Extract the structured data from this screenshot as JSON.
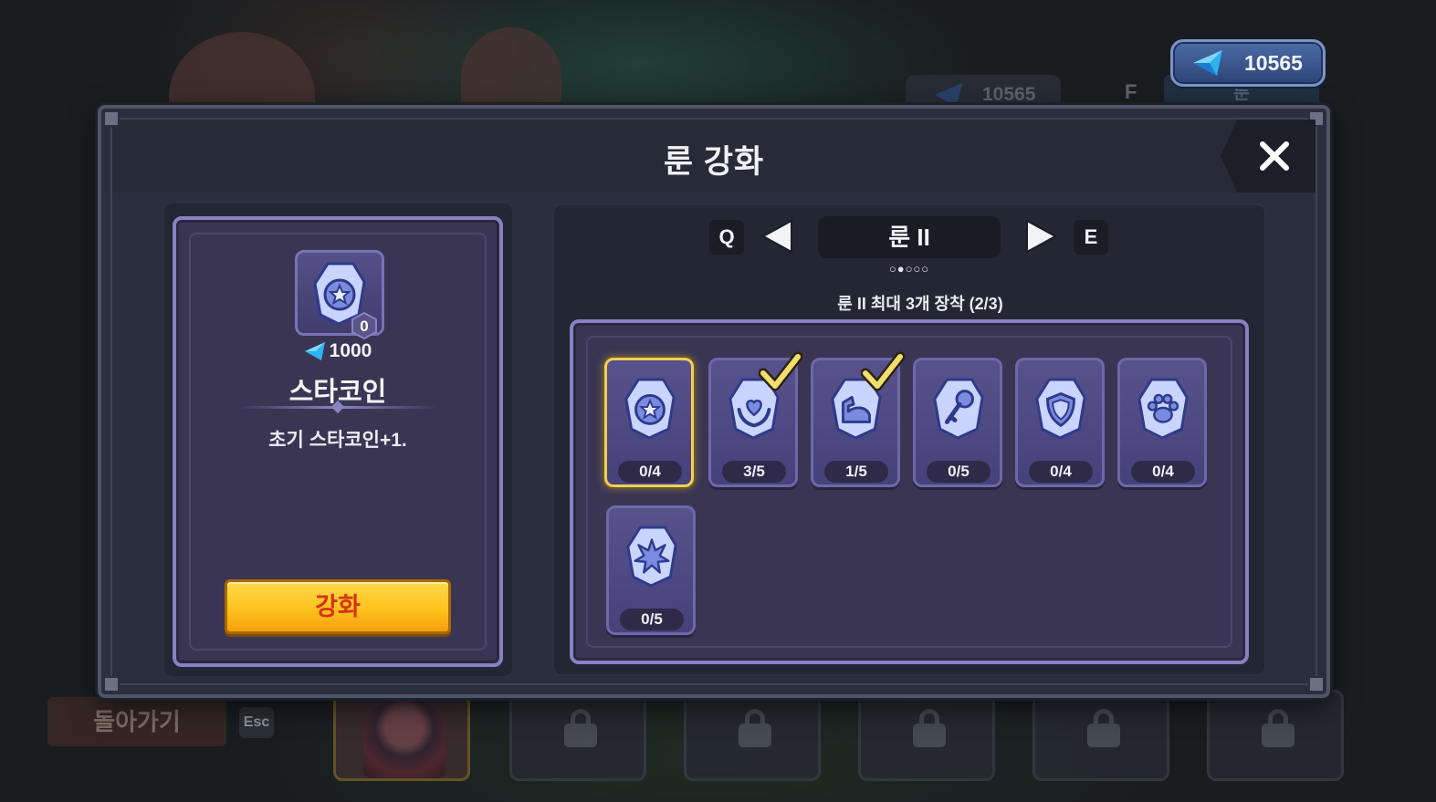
{
  "currency": {
    "gem_count": "10565",
    "icon": "blue-gem-icon"
  },
  "background": {
    "gem_chip_value": "10565",
    "f_key": "F",
    "rune_tab_label": "룬",
    "back_button_label": "돌아가기",
    "esc_key": "Esc"
  },
  "modal": {
    "title": "룬 강화",
    "close_icon": "close-icon"
  },
  "selected_rune": {
    "level": "0",
    "cost": "1000",
    "name": "스타코인",
    "description": "초기 스타코인+1.",
    "upgrade_label": "강화",
    "icon": "star-rune-icon"
  },
  "rune_page": {
    "prev_key": "Q",
    "next_key": "E",
    "label": "룬 II",
    "dots": "○●○○○",
    "equip_info": "룬 II 최대 3개 장착 (2/3)"
  },
  "runes": [
    {
      "icon": "star-rune-icon",
      "level": "0/4",
      "equipped": false,
      "selected": true
    },
    {
      "icon": "heart-hands-rune-icon",
      "level": "3/5",
      "equipped": true,
      "selected": false
    },
    {
      "icon": "muscle-arm-rune-icon",
      "level": "1/5",
      "equipped": true,
      "selected": false
    },
    {
      "icon": "key-rune-icon",
      "level": "0/5",
      "equipped": false,
      "selected": false
    },
    {
      "icon": "shield-rune-icon",
      "level": "0/4",
      "equipped": false,
      "selected": false
    },
    {
      "icon": "paw-rune-icon",
      "level": "0/4",
      "equipped": false,
      "selected": false
    },
    {
      "icon": "burst-rune-icon",
      "level": "0/5",
      "equipped": false,
      "selected": false
    }
  ],
  "colors": {
    "accent_gold": "#f0cf5a",
    "upgrade_button": "#ffc21e",
    "upgrade_text": "#d33512",
    "panel_purple": "#3a3553",
    "panel_border": "#8a80c4"
  }
}
